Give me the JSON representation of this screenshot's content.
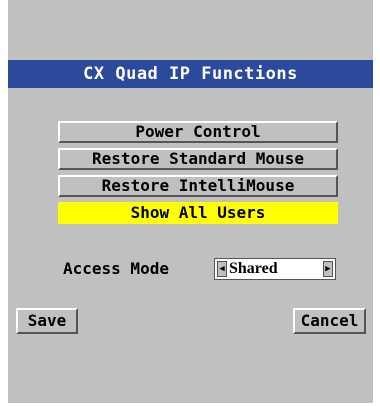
{
  "window": {
    "title": "CX Quad IP Functions"
  },
  "menu": {
    "items": [
      {
        "label": "Power Control",
        "selected": false
      },
      {
        "label": "Restore Standard Mouse",
        "selected": false
      },
      {
        "label": "Restore IntelliMouse",
        "selected": false
      },
      {
        "label": "Show All Users",
        "selected": true
      }
    ]
  },
  "access": {
    "label": "Access Mode",
    "value": "Shared"
  },
  "actions": {
    "save_label": "Save",
    "cancel_label": "Cancel"
  },
  "icons": {
    "spin_left": "left-arrow-icon",
    "spin_right": "right-arrow-icon"
  },
  "colors": {
    "title_bar": "#2b4a9b",
    "panel": "#c0c0c0",
    "selected_item": "#ffff00"
  }
}
